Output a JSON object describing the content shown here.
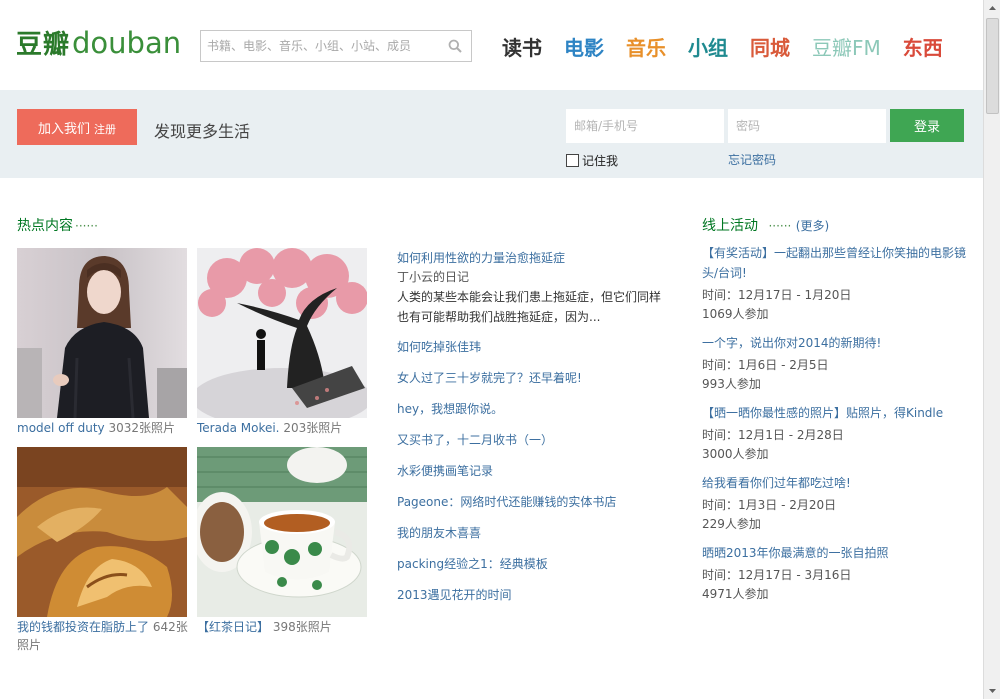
{
  "header": {
    "logo_cn": "豆瓣",
    "logo_en": "douban",
    "search_placeholder": "书籍、电影、音乐、小组、小站、成员",
    "nav": [
      {
        "label": "读书",
        "color": "#333333"
      },
      {
        "label": "电影",
        "color": "#2e84c4"
      },
      {
        "label": "音乐",
        "color": "#e8902a"
      },
      {
        "label": "小组",
        "color": "#1f8a90"
      },
      {
        "label": "同城",
        "color": "#d95a3a"
      },
      {
        "label": "豆瓣FM",
        "color": "#8cc8b8"
      },
      {
        "label": "东西",
        "color": "#d94a3a"
      }
    ]
  },
  "band": {
    "join_label": "加入我们",
    "join_sub": "注册",
    "tagline": "发现更多生活",
    "email_placeholder": "邮箱/手机号",
    "password_placeholder": "密码",
    "login_label": "登录",
    "remember_label": "记住我",
    "forgot_label": "忘记密码"
  },
  "hot": {
    "title": "热点内容",
    "dots": "······",
    "albums": [
      {
        "name": "model off duty",
        "count": "3032张照片"
      },
      {
        "name": "Terada Mokei.",
        "count": "203张照片"
      },
      {
        "name": "我的钱都投资在脂肪上了",
        "count": "642张照片"
      },
      {
        "name": "【红茶日记】",
        "count": "398张照片"
      }
    ],
    "featured": {
      "title": "如何利用性欲的力量治愈拖延症",
      "source": "丁小云的日记",
      "desc": "人类的某些本能会让我们患上拖延症，但它们同样也有可能帮助我们战胜拖延症，因为..."
    },
    "articles": [
      "如何吃掉张佳玮",
      "女人过了三十岁就完了？还早着呢!",
      "hey，我想跟你说。",
      "又买书了，十二月收书（一）",
      "水彩便携画笔记录",
      "Pageone：网络时代还能赚钱的实体书店",
      "我的朋友木喜喜",
      "packing经验之1：经典模板",
      "2013遇见花开的时间"
    ]
  },
  "events": {
    "title": "线上活动",
    "dots": "······",
    "more": "(更多)",
    "items": [
      {
        "title": "【有奖活动】一起翻出那些曾经让你笑抽的电影镜头/台词!",
        "time": "时间：12月17日 - 1月20日",
        "count": "1069人参加"
      },
      {
        "title": "一个字，说出你对2014的新期待!",
        "time": "时间：1月6日 - 2月5日",
        "count": "993人参加"
      },
      {
        "title": "【晒一晒你最性感的照片】贴照片，得Kindle",
        "time": "时间：12月1日 - 2月28日",
        "count": "3000人参加"
      },
      {
        "title": "给我看看你们过年都吃过啥!",
        "time": "时间：1月3日 - 2月20日",
        "count": "229人参加"
      },
      {
        "title": "晒晒2013年你最满意的一张自拍照",
        "time": "时间：12月17日 - 3月16日",
        "count": "4971人参加"
      }
    ]
  }
}
